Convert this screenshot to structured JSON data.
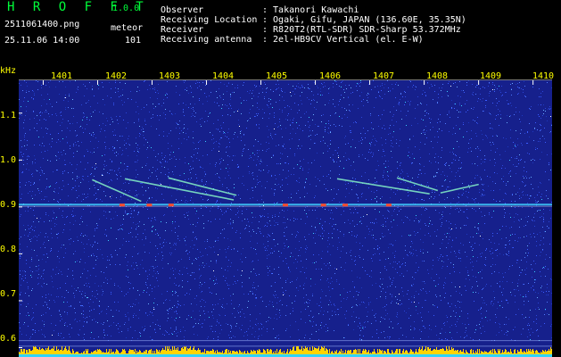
{
  "app": {
    "name": "H R O F F T",
    "version": "1.0.0"
  },
  "file": {
    "name": "2511061400.png",
    "datetime": "25.11.06 14:00"
  },
  "counter": {
    "label": "meteor",
    "value": "101"
  },
  "info": [
    {
      "label": "Observer",
      "value": ": Takanori Kawachi"
    },
    {
      "label": "Receiving Location",
      "value": ": Ogaki, Gifu, JAPAN (136.60E, 35.35N)"
    },
    {
      "label": "Receiver",
      "value": ": R820T2(RTL-SDR) SDR-Sharp 53.372MHz"
    },
    {
      "label": "Receiving antenna",
      "value": ": 2el-HB9CV Vertical (el. E-W)"
    }
  ],
  "axis": {
    "unit": "kHz",
    "x_ticks": [
      "1401",
      "1402",
      "1403",
      "1404",
      "1405",
      "1406",
      "1407",
      "1408",
      "1409",
      "1410"
    ],
    "y_ticks": [
      "1.1",
      "1.0",
      "0.9",
      "0.8",
      "0.7",
      "0.6"
    ],
    "x_range": [
      1400.55,
      1410.35
    ],
    "y_range": [
      0.58,
      1.17
    ]
  },
  "colors": {
    "background": "#000000",
    "spectrogram_base": "#16208c",
    "app_name": "#00ff3a",
    "label_text": "#ffffff",
    "tick_text": "#ffff00",
    "carrier_line": "#3fd0ff",
    "meteor_trace": "#7fe6c4",
    "hot_spot": "#ff4a2a",
    "noise_floor": "#ffd400"
  }
}
